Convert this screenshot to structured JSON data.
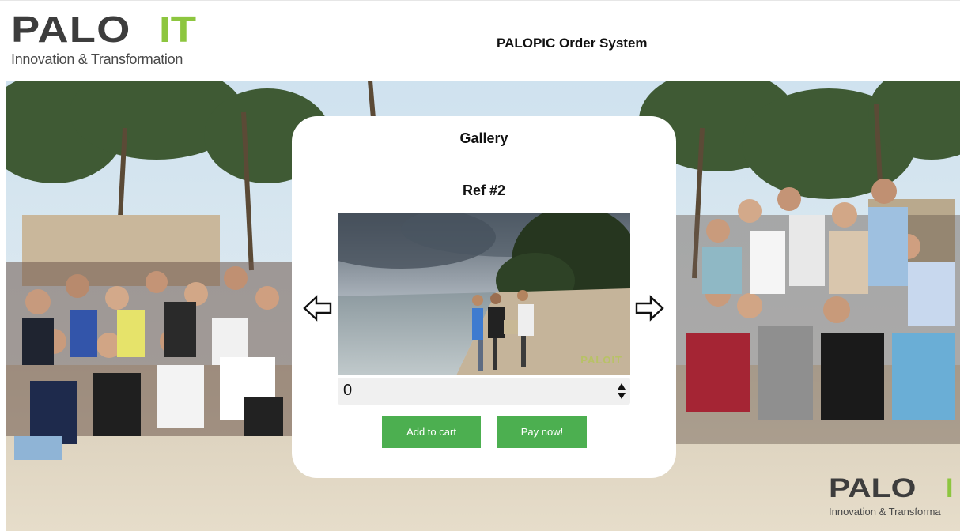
{
  "header": {
    "logo_word": "PALO",
    "logo_accent": "IT",
    "logo_tagline": "Innovation & Transformation",
    "title": "PALOPIC Order System"
  },
  "gallery": {
    "title": "Gallery",
    "ref_label": "Ref #2",
    "photo_watermark_a": "PALO",
    "photo_watermark_b": "IT",
    "quantity_value": "0",
    "add_to_cart_label": "Add to cart",
    "pay_now_label": "Pay now!",
    "prev_icon": "arrow-left-icon",
    "next_icon": "arrow-right-icon",
    "spinner_icon": "up-down-spinner-icon"
  },
  "watermark": {
    "word": "PALO",
    "accent": "I",
    "tagline": "Innovation & Transforma"
  },
  "colors": {
    "brand_green": "#8dc63f",
    "button_green": "#4caf50",
    "logo_gray": "#3d3d3d"
  }
}
